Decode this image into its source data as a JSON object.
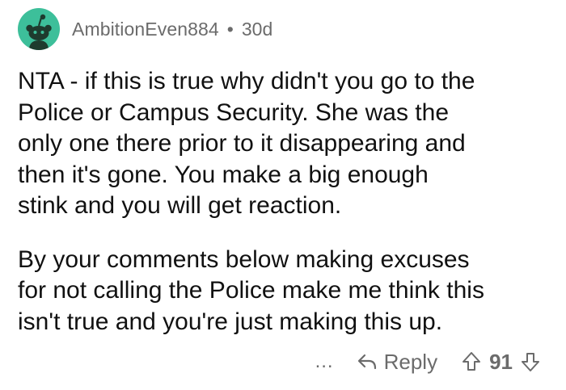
{
  "comment": {
    "username": "AmbitionEven884",
    "separator": "•",
    "age": "30d",
    "paragraphs": [
      "NTA - if this is true why didn't you go to the\nPolice or Campus Security.  She was the\nonly one there prior to it disappearing and\nthen it's gone.  You make a big enough\nstink and you will get reaction.",
      "By your comments below making excuses\nfor not calling the Police make me think this\nisn't true and you're just making this up."
    ]
  },
  "actions": {
    "more_label": "...",
    "reply_label": "Reply",
    "vote_count": "91"
  },
  "icons": {
    "avatar": "reddit-snoo-avatar-icon",
    "reply": "reply-arrow-icon",
    "upvote": "upvote-arrow-icon",
    "downvote": "downvote-arrow-icon"
  },
  "colors": {
    "avatar_bg": "#3dbf9a",
    "meta_text": "#6b6b6b",
    "body_text": "#111111"
  }
}
